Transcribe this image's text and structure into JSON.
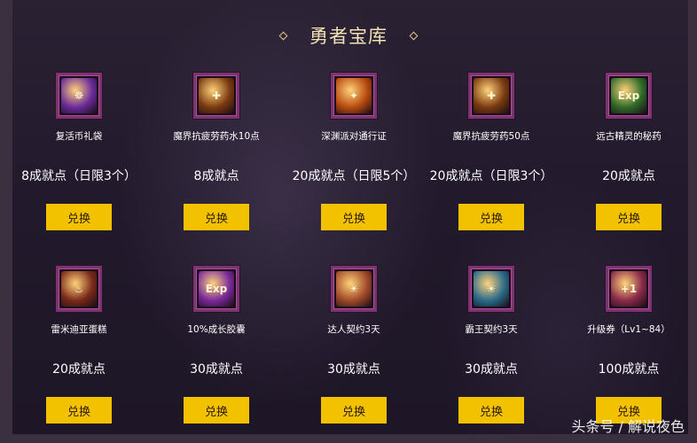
{
  "title": "勇者宝库",
  "items": [
    {
      "name": "复活币礼袋",
      "cost": "8成就点（日限3个）",
      "button": "兑换",
      "icon": "gift-bag-icon",
      "color": "#6a2a9a"
    },
    {
      "name": "魔界抗疲劳药水10点",
      "cost": "8成就点",
      "button": "兑换",
      "icon": "potion-icon",
      "color": "#7a3a10"
    },
    {
      "name": "深渊派对通行证",
      "cost": "20成就点（日限5个）",
      "button": "兑换",
      "icon": "pass-icon",
      "color": "#b84a10"
    },
    {
      "name": "魔界抗疲劳药50点",
      "cost": "20成就点（日限3个）",
      "button": "兑换",
      "icon": "potion-icon",
      "color": "#7a3a10"
    },
    {
      "name": "远古精灵的秘药",
      "cost": "20成就点",
      "button": "兑换",
      "icon": "exp-potion-icon",
      "color": "#2e6a2a"
    },
    {
      "name": "雷米迪亚蛋糕",
      "cost": "20成就点",
      "button": "兑换",
      "icon": "cake-icon",
      "color": "#7a2a1a"
    },
    {
      "name": "10%成长胶囊",
      "cost": "30成就点",
      "button": "兑换",
      "icon": "exp-capsule-icon",
      "color": "#7a2a9a"
    },
    {
      "name": "达人契约3天",
      "cost": "30成就点",
      "button": "兑换",
      "icon": "contract-icon",
      "color": "#a04a2a"
    },
    {
      "name": "霸王契约3天",
      "cost": "30成就点",
      "button": "兑换",
      "icon": "contract-icon",
      "color": "#2a6a8a"
    },
    {
      "name": "升级券（Lv1~84）",
      "cost": "100成就点",
      "button": "兑换",
      "icon": "level-ticket-icon",
      "color": "#8a2a4a"
    }
  ],
  "watermark": "头条号 / 解说夜色"
}
